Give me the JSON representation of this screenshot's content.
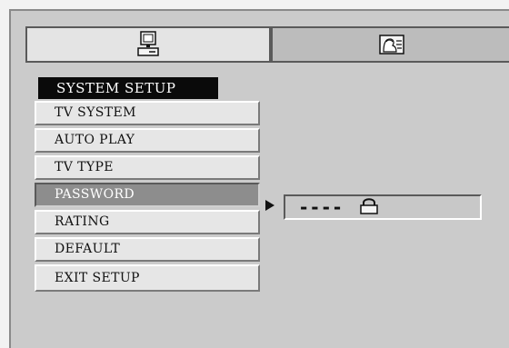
{
  "tabs": [
    {
      "id": "general",
      "icon": "monitor-icon"
    },
    {
      "id": "preference",
      "icon": "person-portrait-icon"
    }
  ],
  "menu": {
    "title": "SYSTEM SETUP",
    "items": [
      {
        "label": "TV SYSTEM"
      },
      {
        "label": "AUTO PLAY"
      },
      {
        "label": "TV TYPE"
      },
      {
        "label": "PASSWORD",
        "selected": true
      },
      {
        "label": "RATING"
      },
      {
        "label": "DEFAULT"
      },
      {
        "label": "EXIT SETUP"
      }
    ]
  },
  "password": {
    "value": "----",
    "lock_icon": "lock-icon",
    "arrow_icon": "right-pointer-icon"
  },
  "colors": {
    "panel": "#cbcbcb",
    "highlight": "#8d8d8d",
    "title_bg": "#0a0a0a"
  }
}
